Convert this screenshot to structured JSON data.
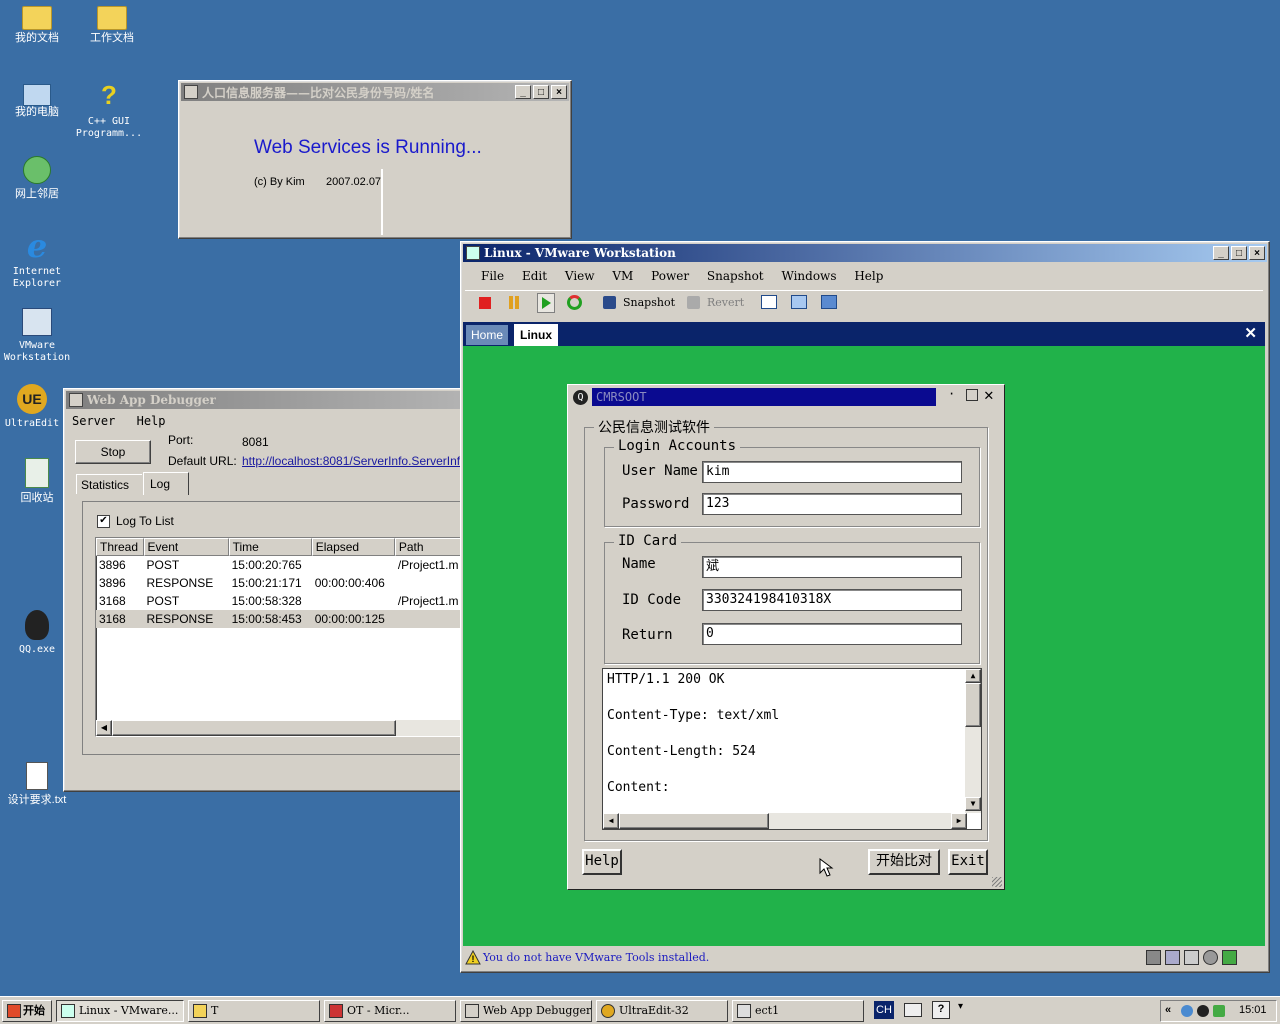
{
  "desktop": {
    "icons": [
      {
        "label": "我的文档",
        "icon": "documents-folder-icon"
      },
      {
        "label": "工作文档",
        "icon": "folder-icon"
      },
      {
        "label": "我的电脑",
        "icon": "computer-icon"
      },
      {
        "label": "C++ GUI Programm...",
        "icon": "shortcut-help-icon"
      },
      {
        "label": "网上邻居",
        "icon": "network-icon"
      },
      {
        "label": "Internet Explorer",
        "icon": "internet-explorer-icon"
      },
      {
        "label": "VMware Workstation",
        "icon": "vmware-icon"
      },
      {
        "label": "UltraEdit",
        "icon": "ultraedit-icon"
      },
      {
        "label": "回收站",
        "icon": "recycle-bin-icon"
      },
      {
        "label": "QQ.exe",
        "icon": "qq-penguin-icon"
      },
      {
        "label": "设计要求.txt",
        "icon": "text-file-icon"
      }
    ]
  },
  "server_window": {
    "title": "人口信息服务器——比对公民身份号码/姓名",
    "status": "Web Services is Running...",
    "copyright": "(c) By Kim",
    "date": "2007.02.07"
  },
  "debugger": {
    "title": "Web App Debugger",
    "menu": [
      "Server",
      "Help"
    ],
    "stop_label": "Stop",
    "port_label": "Port:",
    "port_value": "8081",
    "url_label": "Default URL:",
    "url_value": "http://localhost:8081/ServerInfo.ServerInf",
    "tabs": [
      "Statistics",
      "Log"
    ],
    "log_to_list_label": "Log To List",
    "columns": [
      "Thread",
      "Event",
      "Time",
      "Elapsed",
      "Path"
    ],
    "rows": [
      {
        "thread": "3896",
        "event": "POST",
        "time": "15:00:20:765",
        "elapsed": "",
        "path": "/Project1.m"
      },
      {
        "thread": "3896",
        "event": "RESPONSE",
        "time": "15:00:21:171",
        "elapsed": "00:00:00:406",
        "path": ""
      },
      {
        "thread": "3168",
        "event": "POST",
        "time": "15:00:58:328",
        "elapsed": "",
        "path": "/Project1.m"
      },
      {
        "thread": "3168",
        "event": "RESPONSE",
        "time": "15:00:58:453",
        "elapsed": "00:00:00:125",
        "path": ""
      }
    ]
  },
  "vmware": {
    "title": "Linux - VMware Workstation",
    "menu": [
      "File",
      "Edit",
      "View",
      "VM",
      "Power",
      "Snapshot",
      "Windows",
      "Help"
    ],
    "toolbar": {
      "snapshot": "Snapshot",
      "revert": "Revert"
    },
    "tabs": [
      "Home",
      "Linux"
    ],
    "status_message": "You do not have VMware Tools installed.",
    "guest_bg": "#21b24a"
  },
  "qt_app": {
    "title": "CMRSOOT",
    "main_group": "公民信息测试软件",
    "login_group": "Login Accounts",
    "user_name_label": "User Name",
    "user_name_value": "kim",
    "password_label": "Password",
    "password_value": "123",
    "id_group": "ID Card",
    "name_label": "Name",
    "name_value": "斌",
    "id_code_label": "ID Code",
    "id_code_value": "330324198410318X",
    "return_label": "Return",
    "return_value": "0",
    "response_lines": [
      "HTTP/1.1 200 OK",
      "Content-Type: text/xml",
      "Content-Length: 524",
      "Content:"
    ],
    "help_label": "Help",
    "compare_label": "开始比对",
    "exit_label": "Exit"
  },
  "taskbar": {
    "start_label": "开始",
    "items": [
      "Linux - VMware...",
      "T",
      "OT - Micr...",
      "Web App Debugger",
      "UltraEdit-32",
      "ect1"
    ],
    "ime": "CH",
    "clock": "15:01"
  }
}
